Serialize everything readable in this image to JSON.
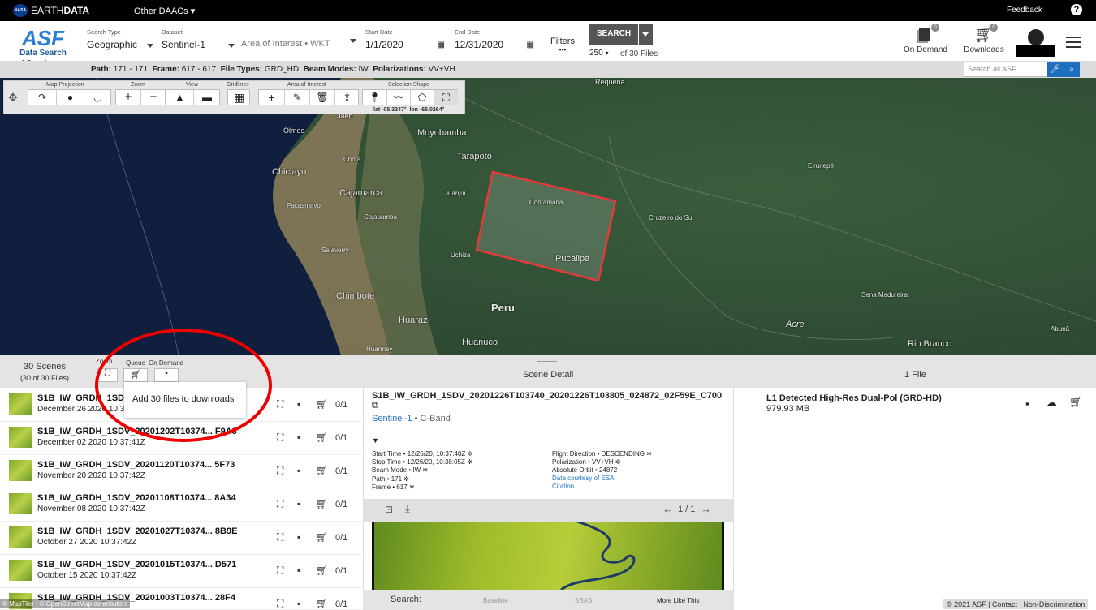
{
  "topbar": {
    "brand_pre": "EARTH",
    "brand_bold": "DATA",
    "nasa": "NASA",
    "daacs": "Other DAACs",
    "feedback": "Feedback",
    "help": "?"
  },
  "logo": {
    "asf": "ASF",
    "data_search": "Data Search",
    "vertex": "Vertex"
  },
  "search": {
    "type_label": "Search Type",
    "type_value": "Geographic",
    "dataset_label": "Dataset",
    "dataset_value": "Sentinel-1",
    "aoi_placeholder": "Area of Interest • WKT",
    "start_label": "Start Date",
    "start_value": "1/1/2020",
    "end_label": "End Date",
    "end_value": "12/31/2020",
    "filters_label": "Filters",
    "filters_dots": "•••",
    "search_button": "SEARCH",
    "max_results": "250",
    "of_files": "of 30 Files"
  },
  "header_right": {
    "on_demand": "On Demand",
    "on_demand_count": "0",
    "downloads": "Downloads",
    "downloads_count": "0"
  },
  "infobar": {
    "path_label": "Path:",
    "path": "171 - 171",
    "frame_label": "Frame:",
    "frame": "617 - 617",
    "ft_label": "File Types:",
    "file_types": "GRD_HD",
    "bm_label": "Beam Modes:",
    "beam_modes": "IW",
    "pol_label": "Polarizations:",
    "pols": "VV+VH",
    "search_all_placeholder": "Search all ASF"
  },
  "toolbar": {
    "map_projection": "Map Projection",
    "zoom": "Zoom",
    "view": "View",
    "gridlines": "Gridlines",
    "aoi": "Area of Interest",
    "selection_shape": "Selection Shape",
    "lat": "lat -05.3247°",
    "lon": "lon -65.0264°"
  },
  "map_labels": [
    "Requena",
    "Jaén",
    "Moyobamba",
    "Olmos",
    "Chota",
    "Tarapoto",
    "Chiclayo",
    "Cajamarca",
    "Juanjui",
    "Contamana",
    "Eirunepé",
    "Cruzeiro do Sul",
    "Pacasmayo",
    "Cajabamba",
    "Salaverry",
    "Pucallpa",
    "Chimbote",
    "Peru",
    "Sena Madureira",
    "Huaraz",
    "Acre",
    "Abunã",
    "Huarmey",
    "Huanuco",
    "Rio Branco",
    "Uchiza"
  ],
  "results": {
    "scenes": "30 Scenes",
    "files_sub": "(30 of 30 Files)",
    "zoom": "Zoom",
    "queue": "Queue",
    "on_demand": "On Demand",
    "scene_detail": "Scene Detail",
    "file_count": "1 File",
    "tooltip": "Add 30 files to downloads"
  },
  "rows": [
    {
      "name": "S1B_IW_GRDH_1SDV",
      "date": "December 26 2020 10:37",
      "count": "0/1"
    },
    {
      "name": "S1B_IW_GRDH_1SDV_20201202T10374... F9A3",
      "date": "December 02 2020 10:37:41Z",
      "count": "0/1"
    },
    {
      "name": "S1B_IW_GRDH_1SDV_20201120T10374... 5F73",
      "date": "November 20 2020 10:37:42Z",
      "count": "0/1"
    },
    {
      "name": "S1B_IW_GRDH_1SDV_20201108T10374... 8A34",
      "date": "November 08 2020 10:37:42Z",
      "count": "0/1"
    },
    {
      "name": "S1B_IW_GRDH_1SDV_20201027T10374... 8B9E",
      "date": "October 27 2020 10:37:42Z",
      "count": "0/1"
    },
    {
      "name": "S1B_IW_GRDH_1SDV_20201015T10374... D571",
      "date": "October 15 2020 10:37:42Z",
      "count": "0/1"
    },
    {
      "name": "S1B_IW_GRDH_1SDV_20201003T10374... 28F4",
      "date": "",
      "count": "0/1"
    }
  ],
  "detail": {
    "title": "S1B_IW_GRDH_1SDV_20201226T103740_20201226T103805_024872_02F59E_C700",
    "dataset_link": "Sentinel-1",
    "band": "• C-Band",
    "start": "Start Time • 12/26/20, 10:37:40Z",
    "stop": "Stop Time • 12/26/20, 10:38:05Z",
    "beam": "Beam Mode • IW",
    "path": "Path • 171",
    "frame": "Frame • 617",
    "flight": "Flight Direction • DESCENDING",
    "pol": "Polarization • VV+VH",
    "orbit": "Absolute Orbit • 24872",
    "courtesy": "Data courtesy of ESA",
    "citation": "Citation",
    "pager": "1 / 1",
    "search_label": "Search:",
    "baseline": "Baseline",
    "sbas": "SBAS",
    "more_like": "More Like This"
  },
  "file": {
    "title": "L1 Detected High-Res Dual-Pol (GRD-HD)",
    "size": "979.93 MB"
  },
  "footer": {
    "left": "© MapTiler | © OpenStreetMap contributors",
    "right": "© 2021 ASF  | Contact  | Non-Discrimination"
  }
}
